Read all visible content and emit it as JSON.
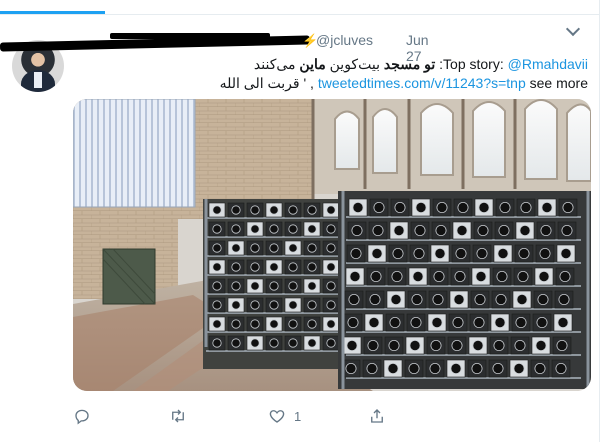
{
  "tweet": {
    "handle": "@jcluves",
    "date": "Jun 27",
    "text_line1_prefix": "Top story:",
    "mention": "@Rmahdavii",
    "text_line1_bold1": "تو مسجد",
    "text_line1_mid": "بیت‌کوین",
    "text_line1_bold2": "ماین",
    "text_line1_tail": "می‌کنند",
    "link": "tweetedtimes.com/v/11243?s=tnp",
    "see_more": "see more",
    "text_line2_tail": ", ' قربت الی الله"
  },
  "actions": {
    "reply_label": "Reply",
    "retweet_label": "Retweet",
    "like_count": "1",
    "share_label": "Share"
  },
  "colors": {
    "accent": "#1da1f2",
    "link": "#1b95e0",
    "muted": "#657786",
    "text": "#14171a"
  },
  "icons": {
    "reply": "reply-icon",
    "retweet": "retweet-icon",
    "like": "heart-icon",
    "share": "share-icon",
    "menu": "chevron-down-icon",
    "verified": "verified-icon"
  }
}
